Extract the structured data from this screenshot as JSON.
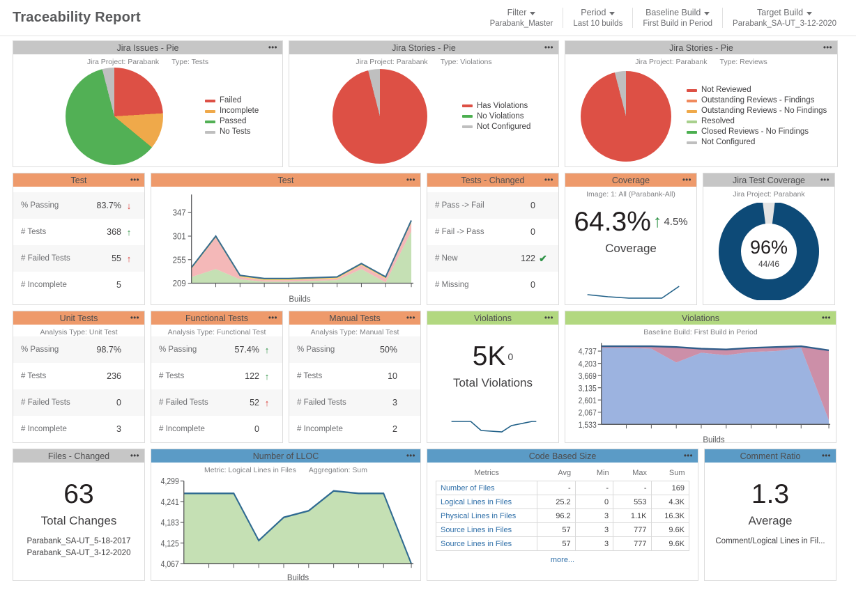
{
  "header": {
    "title": "Traceability Report",
    "controls": [
      {
        "label": "Filter",
        "value": "Parabank_Master"
      },
      {
        "label": "Period",
        "value": "Last 10 builds"
      },
      {
        "label": "Baseline Build",
        "value": "First Build in Period"
      },
      {
        "label": "Target Build",
        "value": "Parabank_SA-UT_3-12-2020"
      }
    ]
  },
  "colors": {
    "header_gray": "#c6c6c6",
    "header_orange": "#ee9a6b",
    "header_green": "#b2d880",
    "header_blue": "#5b9bc6",
    "red": "#dd5045",
    "orange": "#efa94a",
    "green": "#52b055",
    "gray": "#bfbfbf",
    "light_green": "#a8d08d",
    "dark_blue": "#0d4a77",
    "line_blue": "#1f5f87",
    "area_green": "#c5e0b4",
    "area_pink": "#f4b8b8",
    "area_yellow": "#ffd966",
    "area_blue": "#9cb3e0",
    "area_mauve": "#cc8fa8",
    "link_blue": "#2f6fa8"
  },
  "widgets": {
    "jira_issues_pie": {
      "title": "Jira Issues - Pie",
      "sub_left": "Jira Project: Parabank",
      "sub_right": "Type: Tests",
      "menu": "•••"
    },
    "jira_stories_violations_pie": {
      "title": "Jira Stories - Pie",
      "sub_left": "Jira Project: Parabank",
      "sub_right": "Type: Violations",
      "menu": "•••"
    },
    "jira_stories_reviews_pie": {
      "title": "Jira Stories - Pie",
      "sub_left": "Jira Project: Parabank",
      "sub_right": "Type: Reviews",
      "menu": "•••"
    },
    "test_stats": {
      "title": "Test",
      "menu": "•••",
      "rows": [
        {
          "name": "% Passing",
          "value": "83.7%",
          "trend": "down-red",
          "glyph": "↓"
        },
        {
          "name": "# Tests",
          "value": "368",
          "trend": "up-green",
          "glyph": "↑"
        },
        {
          "name": "# Failed Tests",
          "value": "55",
          "trend": "up-red",
          "glyph": "↑"
        },
        {
          "name": "# Incomplete",
          "value": "5",
          "trend": "none",
          "glyph": ""
        }
      ]
    },
    "test_chart": {
      "title": "Test",
      "menu": "•••",
      "xlabel": "Builds"
    },
    "tests_changed": {
      "title": "Tests - Changed",
      "menu": "•••",
      "rows": [
        {
          "name": "# Pass -> Fail",
          "value": "0",
          "trend": "none",
          "glyph": ""
        },
        {
          "name": "# Fail -> Pass",
          "value": "0",
          "trend": "none",
          "glyph": ""
        },
        {
          "name": "# New",
          "value": "122",
          "trend": "check",
          "glyph": "✔"
        },
        {
          "name": "# Missing",
          "value": "0",
          "trend": "none",
          "glyph": ""
        }
      ]
    },
    "coverage": {
      "title": "Coverage",
      "menu": "•••",
      "sub_left": "Image: 1: All (Parabank-All)",
      "sub_right": "",
      "value": "64.3%",
      "delta": "4.5%",
      "delta_arrow": "↑",
      "label": "Coverage"
    },
    "jira_test_coverage": {
      "title": "Jira Test Coverage",
      "menu": "•••",
      "sub_left": "Jira Project: Parabank",
      "sub_right": "",
      "center_value": "96%",
      "center_sub": "44/46"
    },
    "unit_tests": {
      "title": "Unit Tests",
      "menu": "•••",
      "sub_left": "Analysis Type: Unit Test",
      "sub_right": "",
      "rows": [
        {
          "name": "% Passing",
          "value": "98.7%",
          "trend": "none",
          "glyph": ""
        },
        {
          "name": "# Tests",
          "value": "236",
          "trend": "none",
          "glyph": ""
        },
        {
          "name": "# Failed Tests",
          "value": "0",
          "trend": "none",
          "glyph": ""
        },
        {
          "name": "# Incomplete",
          "value": "3",
          "trend": "none",
          "glyph": ""
        }
      ]
    },
    "functional_tests": {
      "title": "Functional Tests",
      "menu": "•••",
      "sub_left": "Analysis Type: Functional Test",
      "sub_right": "",
      "rows": [
        {
          "name": "% Passing",
          "value": "57.4%",
          "trend": "up-green",
          "glyph": "↑"
        },
        {
          "name": "# Tests",
          "value": "122",
          "trend": "up-green",
          "glyph": "↑"
        },
        {
          "name": "# Failed Tests",
          "value": "52",
          "trend": "up-red",
          "glyph": "↑"
        },
        {
          "name": "# Incomplete",
          "value": "0",
          "trend": "none",
          "glyph": ""
        }
      ]
    },
    "manual_tests": {
      "title": "Manual Tests",
      "menu": "•••",
      "sub_left": "Analysis Type: Manual Test",
      "sub_right": "",
      "rows": [
        {
          "name": "% Passing",
          "value": "50%",
          "trend": "none",
          "glyph": ""
        },
        {
          "name": "# Tests",
          "value": "10",
          "trend": "none",
          "glyph": ""
        },
        {
          "name": "# Failed Tests",
          "value": "3",
          "trend": "none",
          "glyph": ""
        },
        {
          "name": "# Incomplete",
          "value": "2",
          "trend": "none",
          "glyph": ""
        }
      ]
    },
    "violations_total": {
      "title": "Violations",
      "menu": "•••",
      "value": "5K",
      "delta": "0",
      "label": "Total Violations"
    },
    "violations_chart": {
      "title": "Violations",
      "menu": "•••",
      "sub_left": "Baseline Build: First Build in Period",
      "sub_right": "",
      "xlabel": "Builds"
    },
    "files_changed": {
      "title": "Files - Changed",
      "menu": "•••",
      "value": "63",
      "label": "Total Changes",
      "line1": "Parabank_SA-UT_5-18-2017",
      "line2": "Parabank_SA-UT_3-12-2020"
    },
    "lloc_chart": {
      "title": "Number of LLOC",
      "menu": "•••",
      "sub_left": "Metric: Logical Lines in Files",
      "sub_right": "Aggregation: Sum",
      "xlabel": "Builds"
    },
    "code_based_size": {
      "title": "Code Based Size",
      "menu": "•••",
      "columns": [
        "Metrics",
        "Avg",
        "Min",
        "Max",
        "Sum"
      ],
      "rows": [
        [
          "Number of Files",
          "-",
          "-",
          "-",
          "169"
        ],
        [
          "Logical Lines in Files",
          "25.2",
          "0",
          "553",
          "4.3K"
        ],
        [
          "Physical Lines in Files",
          "96.2",
          "3",
          "1.1K",
          "16.3K"
        ],
        [
          "Source Lines in Files",
          "57",
          "3",
          "777",
          "9.6K"
        ],
        [
          "Source Lines in Files",
          "57",
          "3",
          "777",
          "9.6K"
        ]
      ],
      "more": "more..."
    },
    "comment_ratio": {
      "title": "Comment Ratio",
      "menu": "•••",
      "value": "1.3",
      "label": "Average",
      "sub": "Comment/Logical Lines in Fil..."
    }
  },
  "chart_data": [
    {
      "id": "jira_issues_pie",
      "type": "pie",
      "title": "Jira Issues - Pie",
      "legend_position": "right",
      "categories": [
        "Failed",
        "Incomplete",
        "Passed",
        "No Tests"
      ],
      "values": [
        24,
        12,
        60,
        4
      ],
      "colors": [
        "#dd5045",
        "#efa94a",
        "#52b055",
        "#bfbfbf"
      ]
    },
    {
      "id": "jira_stories_violations_pie",
      "type": "pie",
      "title": "Jira Stories - Pie",
      "legend_position": "right",
      "categories": [
        "Has Violations",
        "No Violations",
        "Not Configured"
      ],
      "values": [
        96,
        0,
        4
      ],
      "colors": [
        "#dd5045",
        "#4caf50",
        "#bfbfbf"
      ]
    },
    {
      "id": "jira_stories_reviews_pie",
      "type": "pie",
      "title": "Jira Stories - Pie",
      "legend_position": "right",
      "categories": [
        "Not Reviewed",
        "Outstanding Reviews - Findings",
        "Outstanding Reviews - No Findings",
        "Resolved",
        "Closed Reviews - No Findings",
        "Not Configured"
      ],
      "values": [
        96,
        0,
        0,
        0,
        0,
        4
      ],
      "colors": [
        "#dd5045",
        "#f08a5d",
        "#efa94a",
        "#a8d08d",
        "#4caf50",
        "#bfbfbf"
      ]
    },
    {
      "id": "test_chart",
      "type": "area",
      "title": "Test",
      "xlabel": "Builds",
      "ylabel": "",
      "ylim": [
        209,
        370
      ],
      "yticks": [
        209,
        255,
        301,
        347
      ],
      "x": [
        1,
        2,
        3,
        4,
        5,
        6,
        7,
        8,
        9,
        10
      ],
      "series": [
        {
          "name": "Passed",
          "values": [
            238,
            252,
            240,
            236,
            236,
            237,
            238,
            252,
            240,
            306
          ],
          "color": "#c5e0b4"
        },
        {
          "name": "Failed",
          "values": [
            8,
            55,
            6,
            6,
            6,
            5,
            5,
            55,
            5,
            62
          ],
          "color": "#f4b8b8"
        },
        {
          "name": "Incomplete",
          "values": [
            1,
            1,
            2,
            2,
            2,
            2,
            2,
            1,
            2,
            5
          ],
          "color": "#ffd966"
        }
      ]
    },
    {
      "id": "coverage_sparkline",
      "type": "line",
      "title": "Coverage",
      "x": [
        1,
        2,
        3,
        4,
        5,
        6
      ],
      "values": [
        61,
        60,
        59.8,
        59.8,
        59.8,
        64.3
      ],
      "color": "#1f5f87"
    },
    {
      "id": "jira_test_coverage_donut",
      "type": "pie",
      "title": "Jira Test Coverage",
      "categories": [
        "Covered",
        "Not Covered"
      ],
      "values": [
        96,
        4
      ],
      "colors": [
        "#0d4a77",
        "#e0e0e0"
      ],
      "center_label": "96%",
      "center_sublabel": "44/46"
    },
    {
      "id": "violations_sparkline",
      "type": "line",
      "title": "Total Violations",
      "x": [
        1,
        2,
        3,
        4,
        5,
        6,
        7
      ],
      "values": [
        4750,
        4750,
        4300,
        4240,
        4280,
        4760,
        4760
      ],
      "color": "#1f5f87"
    },
    {
      "id": "violations_chart",
      "type": "area",
      "title": "Violations",
      "xlabel": "Builds",
      "ylim": [
        1533,
        5000
      ],
      "yticks": [
        1533,
        2067,
        2601,
        3135,
        3669,
        4203,
        4737
      ],
      "x": [
        1,
        2,
        3,
        4,
        5,
        6,
        7,
        8,
        9,
        10
      ],
      "series": [
        {
          "name": "Baseline",
          "values": [
            4800,
            4800,
            4790,
            4290,
            4640,
            4570,
            4690,
            4700,
            4800,
            1800
          ],
          "color": "#9cb3e0"
        },
        {
          "name": "New",
          "values": [
            0,
            0,
            20,
            520,
            170,
            230,
            110,
            100,
            0,
            2450
          ],
          "color": "#cc8fa8"
        }
      ]
    },
    {
      "id": "lloc_chart",
      "type": "area",
      "title": "Number of LLOC",
      "xlabel": "Builds",
      "ylim": [
        4067,
        4299
      ],
      "yticks": [
        4067,
        4125,
        4183,
        4241,
        4299
      ],
      "x": [
        1,
        2,
        3,
        4,
        5,
        6,
        7,
        8,
        9,
        10
      ],
      "values": [
        4265,
        4265,
        4265,
        4098,
        4165,
        4183,
        4270,
        4265,
        4265,
        4067
      ],
      "color": "#c5e0b4",
      "line_color": "#1f5f87"
    }
  ]
}
